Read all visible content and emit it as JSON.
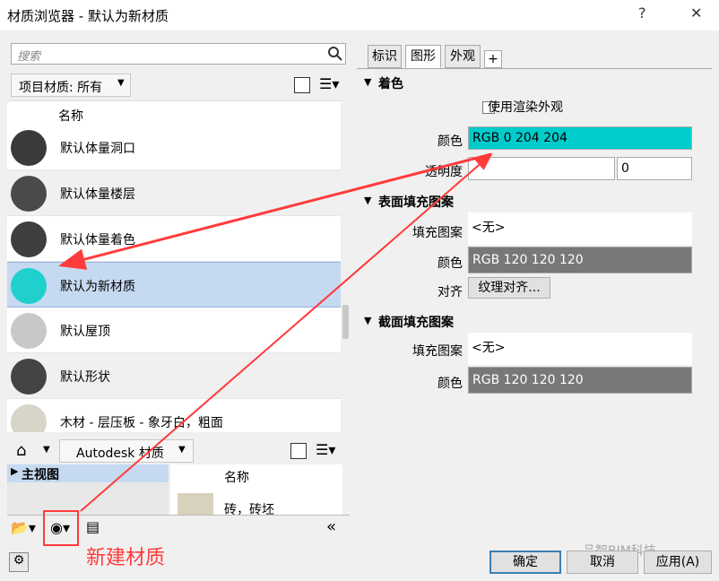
{
  "window": {
    "title": "材质浏览器 - 默认为新材质",
    "help": "?",
    "close": "✕"
  },
  "left": {
    "search_placeholder": "搜索",
    "filter_label": "项目材质: 所有",
    "list_header": "名称",
    "materials": [
      {
        "label": "默认体量洞口",
        "thumb": "#3a3a3a"
      },
      {
        "label": "默认体量楼层",
        "thumb": "#4a4a4a"
      },
      {
        "label": "默认体量着色",
        "thumb": "#3e3e3e"
      },
      {
        "label": "默认为新材质",
        "thumb": "#1fd0cc"
      },
      {
        "label": "默认屋顶",
        "thumb": "#c8c8c8"
      },
      {
        "label": "默认形状",
        "thumb": "#444444"
      },
      {
        "label": "木材 - 层压板 - 象牙白，粗面",
        "thumb": "#d8d4c8"
      }
    ],
    "library": {
      "label": "Autodesk 材质",
      "tree_item": "主视图",
      "grid_header": "名称",
      "grid_item": "砖，砖坯"
    }
  },
  "right": {
    "tabs": [
      "标识",
      "图形",
      "外观",
      "+"
    ],
    "active_tab": "图形",
    "shading": {
      "title": "着色",
      "use_render_label": "使用渲染外观",
      "color_label": "颜色",
      "color_value": "RGB 0 204 204",
      "color_hex": "#00cccc",
      "transparency_label": "透明度",
      "transparency_value": "0"
    },
    "surface": {
      "title": "表面填充图案",
      "pattern_label": "填充图案",
      "pattern_value": "<无>",
      "color_label": "颜色",
      "color_value": "RGB 120 120 120",
      "align_label": "对齐",
      "align_button": "纹理对齐..."
    },
    "cut": {
      "title": "截面填充图案",
      "pattern_label": "填充图案",
      "pattern_value": "<无>",
      "color_label": "颜色",
      "color_value": "RGB 120 120 120"
    }
  },
  "buttons": {
    "ok": "确定",
    "cancel": "取消",
    "apply": "应用(A)"
  },
  "annotation": "新建材质",
  "watermark": "品智BIM科技",
  "colors": {
    "selection": "#c5d9f1",
    "cyan": "#00cccc",
    "gray_swatch": "#787878",
    "annotation_red": "#ff3b3b"
  }
}
